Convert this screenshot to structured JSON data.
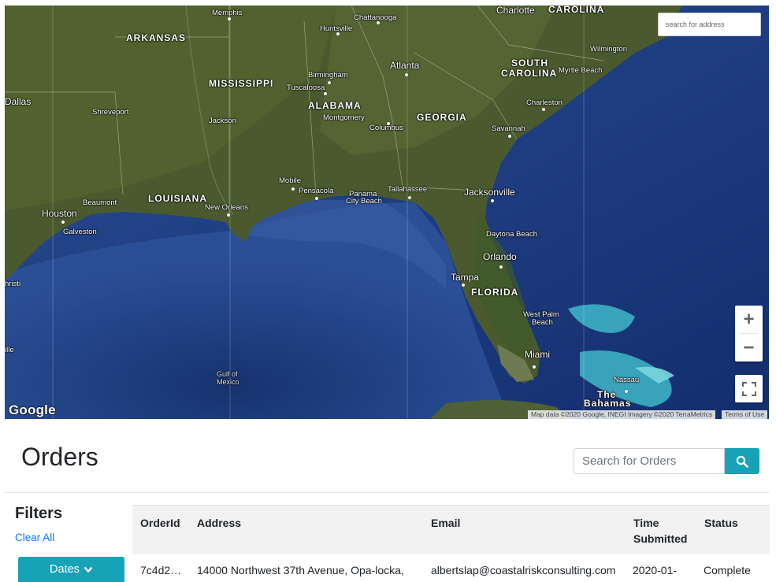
{
  "map": {
    "search_placeholder": "search for address",
    "zoom_in_label": "+",
    "zoom_out_label": "−",
    "google_logo": "Google",
    "attribution": "Map data ©2020 Google, INEGI Imagery ©2020 TerraMetrics",
    "terms": "Terms of Use",
    "labels": {
      "memphis": "Memphis",
      "chattanooga": "Chattanooga",
      "charlotte": "Charlotte",
      "carolina": "CAROLINA",
      "arkansas": "ARKANSAS",
      "huntsville": "Huntsville",
      "wilmington": "Wilmington",
      "atlanta": "Atlanta",
      "south": "SOUTH",
      "carolina2": "CAROLINA",
      "myrtle_beach": "Myrtle Beach",
      "birmingham": "Birmingham",
      "mississippi": "MISSISSIPPI",
      "tuscaloosa": "Tuscaloosa",
      "dallas": "Dallas",
      "alabama": "ALABAMA",
      "charleston": "Charleston",
      "shreveport": "Shreveport",
      "montgomery": "Montgomery",
      "georgia": "GEORGIA",
      "jackson": "Jackson",
      "columbus": "Columbus",
      "savannah": "Savannah",
      "mobile": "Mobile",
      "tallahassee": "Tallahassee",
      "pensacola": "Pensacola",
      "panama": "Panama",
      "city_beach": "City Beach",
      "jacksonville": "Jacksonville",
      "louisiana": "LOUISIANA",
      "beaumont": "Beaumont",
      "new_orleans": "New Orleans",
      "houston": "Houston",
      "galveston": "Galveston",
      "daytona_beach": "Daytona Beach",
      "orlando": "Orlando",
      "tampa": "Tampa",
      "florida": "FLORIDA",
      "christi": "hristi",
      "west_palm": "West Palm",
      "beach": "Beach",
      "miami": "Miami",
      "gulf_of": "Gulf of",
      "mexico": "Mexico",
      "nassau": "Nassau",
      "the": "The",
      "bahamas": "Bahamas",
      "ille": "ille"
    }
  },
  "orders": {
    "title": "Orders",
    "search_placeholder": "Search for Orders",
    "search_icon": "search-icon"
  },
  "filters": {
    "title": "Filters",
    "clear_all": "Clear All",
    "dates_label": "Dates"
  },
  "table": {
    "headers": {
      "order_id": "OrderId",
      "address": "Address",
      "email": "Email",
      "time_line1": "Time",
      "time_line2": "Submitted",
      "status": "Status"
    },
    "rows": [
      {
        "order_id": "7c4d2…",
        "address": "14000 Northwest 37th Avenue, Opa-locka,",
        "email": "albertslap@coastalriskconsulting.com",
        "time": "2020-01-",
        "status": "Complete"
      }
    ]
  }
}
